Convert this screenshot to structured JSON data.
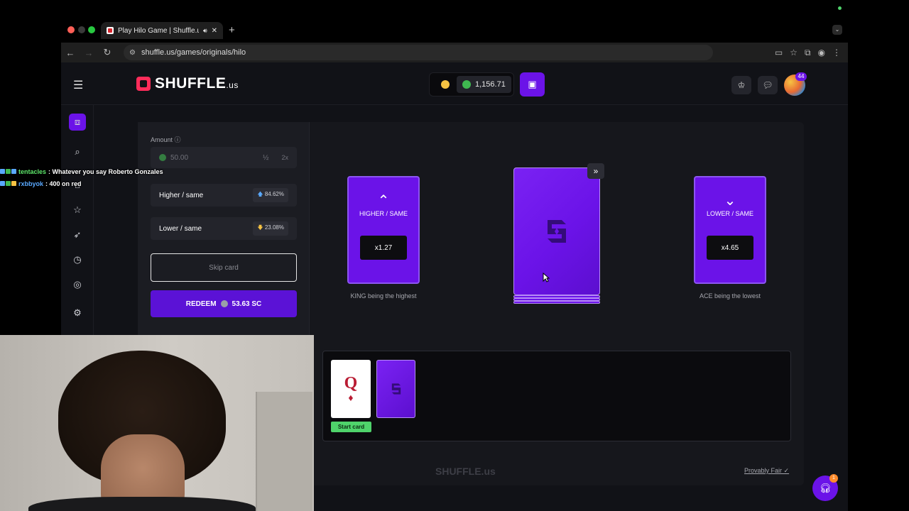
{
  "browser": {
    "tab_title": "Play Hilo Game | Shuffle.us",
    "new_tab": "+",
    "url": "shuffle.us/games/originals/hilo"
  },
  "header": {
    "logo_text": "SHUFFLE",
    "logo_suffix": ".us",
    "balance": "1,156.71",
    "notification_count": "44"
  },
  "controls": {
    "amount_label": "Amount",
    "amount_value": "50.00",
    "half_label": "½",
    "double_label": "2x",
    "higher_label": "Higher / same",
    "higher_pct": "84.62%",
    "lower_label": "Lower / same",
    "lower_pct": "23.08%",
    "skip_label": "Skip card",
    "redeem_label": "REDEEM",
    "redeem_value": "53.63 SC"
  },
  "board": {
    "higher_card": {
      "label": "HIGHER / SAME",
      "multiplier": "x1.27",
      "caption": "KING being the highest"
    },
    "lower_card": {
      "label": "LOWER / SAME",
      "multiplier": "x4.65",
      "caption": "ACE being the lowest"
    }
  },
  "history": {
    "start_card_rank": "Q",
    "start_card_suit": "♦",
    "start_label": "Start card"
  },
  "footer": {
    "logo": "SHUFFLE.us",
    "provably_fair": "Provably Fair ✓"
  },
  "support": {
    "badge": "1"
  },
  "chat": [
    {
      "user": "tentacles",
      "user_color": "#5ee86b",
      "message": ": Whatever you say Roberto Gonzales"
    },
    {
      "user": "rxbbyok",
      "user_color": "#5aa9ff",
      "message": ": 400 on red"
    }
  ],
  "colors": {
    "accent": "#6b13e8",
    "start_green": "#4fd36b",
    "diamond_red": "#b91c33"
  }
}
